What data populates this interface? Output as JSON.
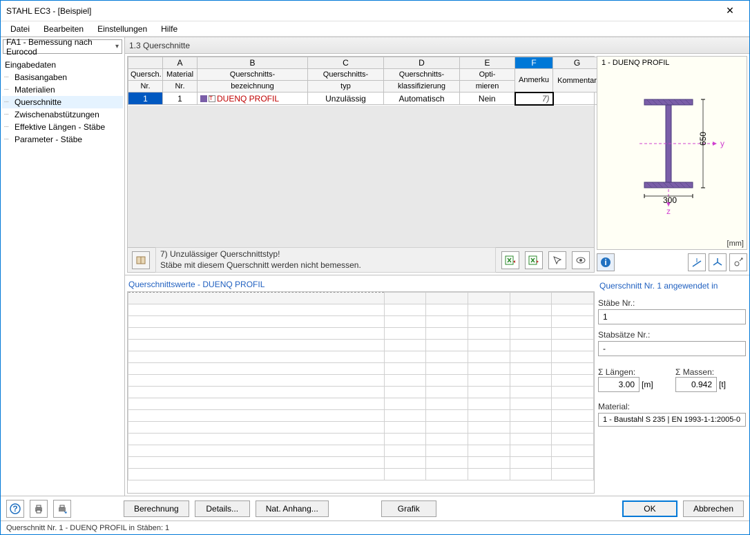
{
  "title": "STAHL EC3 - [Beispiel]",
  "menu": {
    "file": "Datei",
    "edit": "Bearbeiten",
    "settings": "Einstellungen",
    "help": "Hilfe"
  },
  "combo": "FA1 - Bemessung nach Eurocod",
  "tree": {
    "root": "Eingabedaten",
    "items": [
      "Basisangaben",
      "Materialien",
      "Querschnitte",
      "Zwischenabstützungen",
      "Effektive Längen - Stäbe",
      "Parameter - Stäbe"
    ],
    "selected": 2
  },
  "section_title": "1.3 Querschnitte",
  "cols_letters": [
    "A",
    "B",
    "C",
    "D",
    "E",
    "F",
    "G"
  ],
  "cols": {
    "qnr_1": "Quersch.",
    "qnr_2": "Nr.",
    "mat_1": "Material",
    "mat_2": "Nr.",
    "bez_1": "Querschnitts-",
    "bez_2": "bezeichnung",
    "typ_1": "Querschnitts-",
    "typ_2": "typ",
    "klass_1": "Querschnitts-",
    "klass_2": "klassifizierung",
    "opt_1": "Opti-",
    "opt_2": "mieren",
    "anm": "Anmerku",
    "kom": "Kommentar"
  },
  "row": {
    "nr": "1",
    "mat": "1",
    "bez": "DUENQ PROFIL",
    "typ": "Unzulässig",
    "klass": "Automatisch",
    "opt": "Nein",
    "anm": "7)"
  },
  "msg": {
    "line1": "7) Unzulässiger Querschnittstyp!",
    "line2": "Stäbe mit diesem Querschnitt werden nicht bemessen."
  },
  "preview": {
    "title": "1 - DUENQ PROFIL",
    "unit": "[mm]",
    "w": "300",
    "h": "650",
    "ylabel": "y",
    "zlabel": "z"
  },
  "qs_header": "Querschnittswerte  -  DUENQ PROFIL",
  "info": {
    "header": "Querschnitt Nr. 1 angewendet in",
    "stabe_lbl": "Stäbe Nr.:",
    "stabe_val": "1",
    "satz_lbl": "Stabsätze Nr.:",
    "satz_val": "-",
    "len_lbl": "Σ Längen:",
    "len_val": "3.00",
    "len_unit": "[m]",
    "mass_lbl": "Σ Massen:",
    "mass_val": "0.942",
    "mass_unit": "[t]",
    "mat_lbl": "Material:",
    "mat_val": "1 - Baustahl S 235 | EN 1993-1-1:2005-0"
  },
  "buttons": {
    "calc": "Berechnung",
    "details": "Details...",
    "nat": "Nat. Anhang...",
    "grafik": "Grafik",
    "ok": "OK",
    "cancel": "Abbrechen"
  },
  "status": "Querschnitt Nr. 1 - DUENQ PROFIL in Stäben: 1"
}
